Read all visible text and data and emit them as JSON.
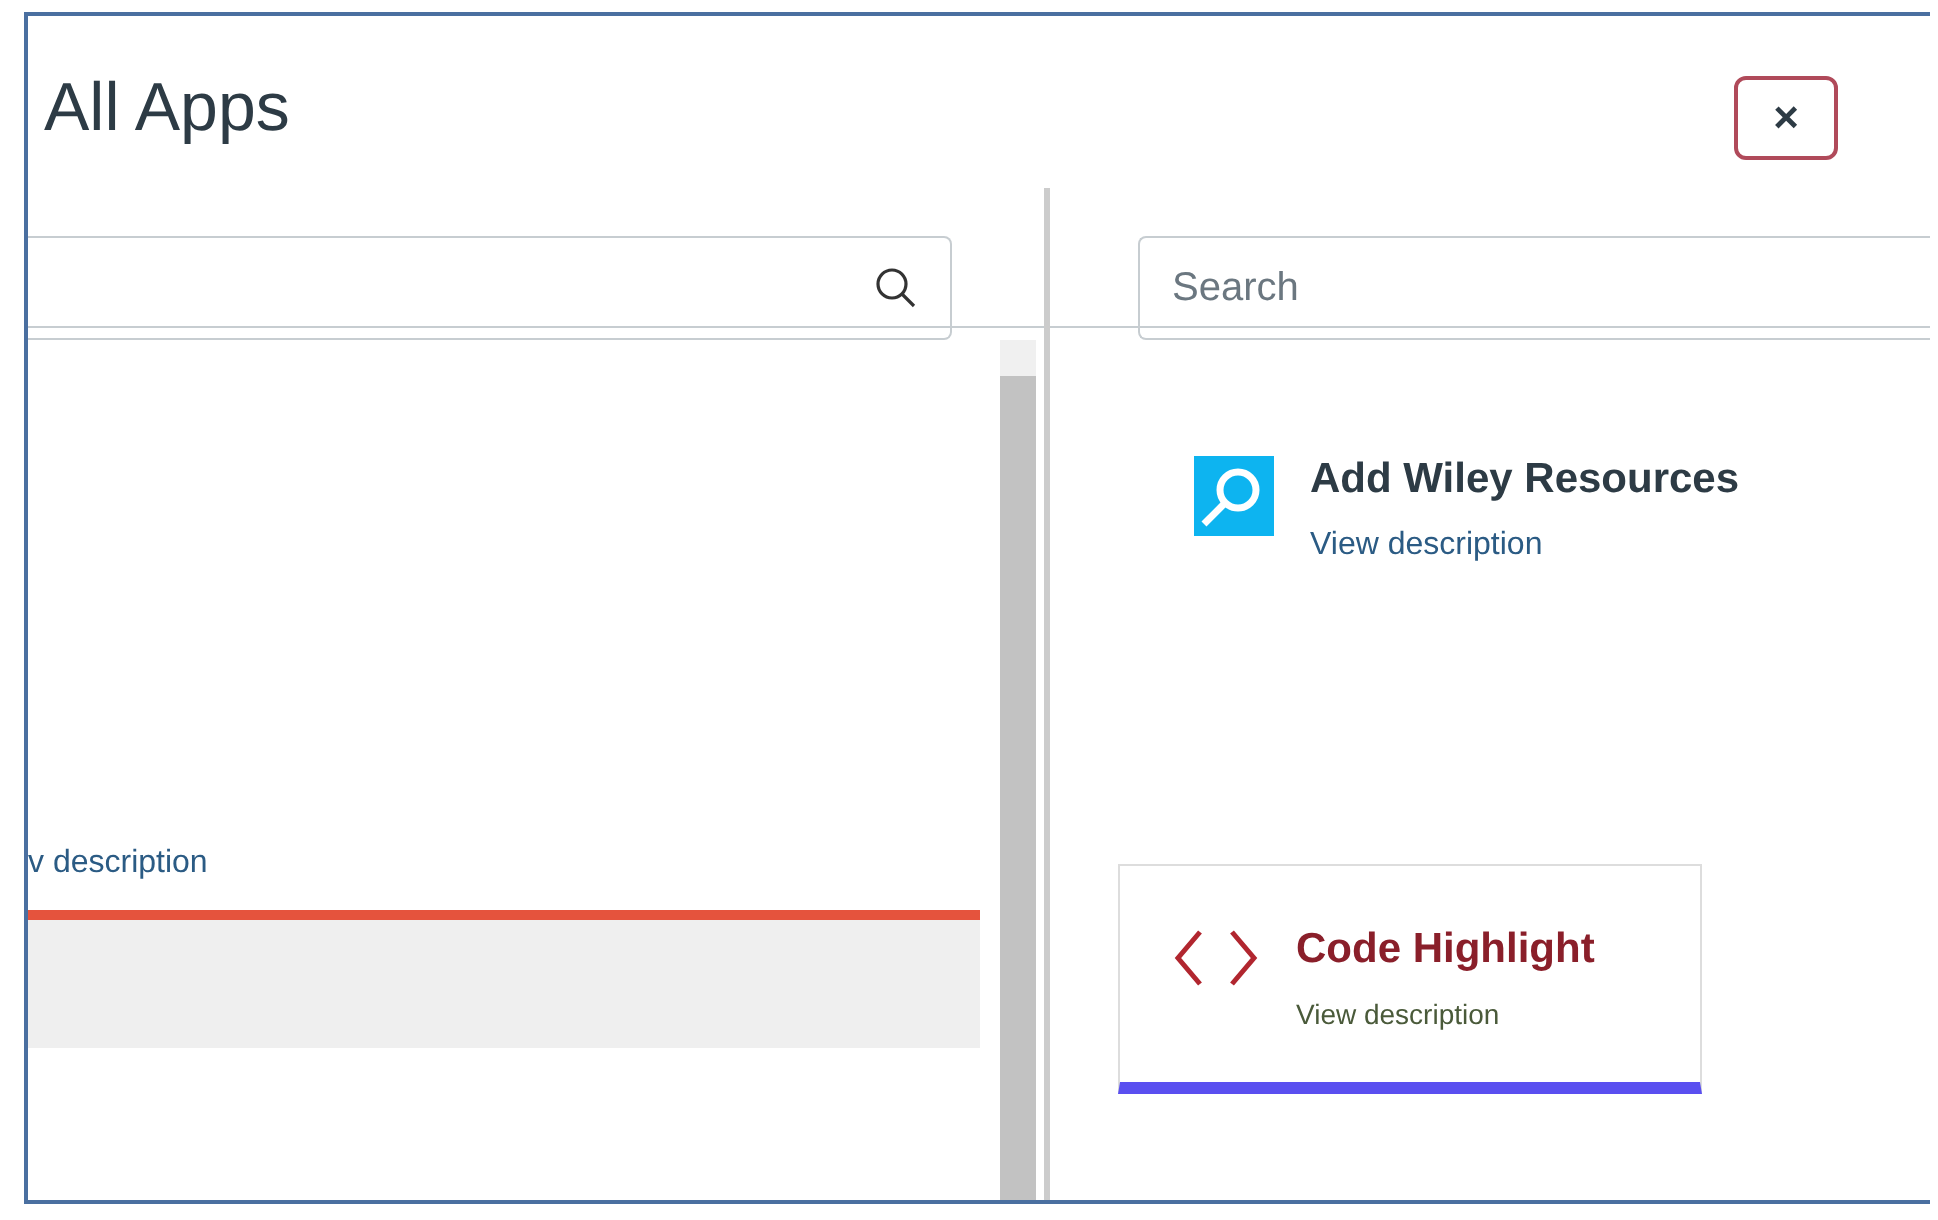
{
  "dialog": {
    "title": "All Apps",
    "close": "×"
  },
  "left_pane": {
    "items": [
      {
        "link": "v description"
      }
    ]
  },
  "right_pane": {
    "search": {
      "placeholder": "Search"
    },
    "items": [
      {
        "name": "Add Wiley Resources",
        "link": "View description",
        "kind": "wiley"
      },
      {
        "name": "Code Highlight",
        "link": "View description",
        "kind": "code"
      }
    ]
  }
}
